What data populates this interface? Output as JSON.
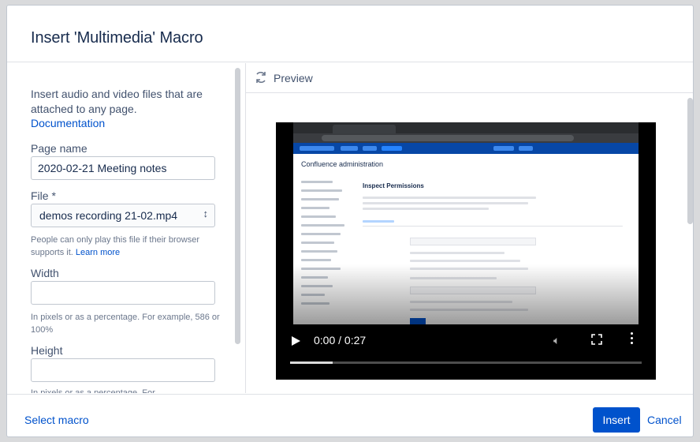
{
  "dialog": {
    "title": "Insert 'Multimedia' Macro"
  },
  "form": {
    "intro": "Insert audio and video files that are attached to any page.",
    "documentation_link": "Documentation",
    "page_name": {
      "label": "Page name",
      "value": "2020-02-21 Meeting notes"
    },
    "file": {
      "label": "File *",
      "selected": "demos recording 21-02.mp4",
      "help": "People can only play this file if their browser supports it.",
      "help_link": "Learn more"
    },
    "width": {
      "label": "Width",
      "value": "",
      "help": "In pixels or as a percentage. For example, 586 or 100%"
    },
    "height": {
      "label": "Height",
      "value": "",
      "help": "In pixels or as a percentage. For"
    }
  },
  "preview": {
    "title": "Preview",
    "video": {
      "time": "0:00 / 0:27",
      "progress": 0.12,
      "screen_title": "Confluence administration",
      "screen_heading": "Inspect Permissions"
    }
  },
  "footer": {
    "select_macro": "Select macro",
    "insert": "Insert",
    "cancel": "Cancel"
  },
  "colors": {
    "primary": "#0052cc",
    "text": "#172b4d",
    "subtle": "#42526e"
  }
}
